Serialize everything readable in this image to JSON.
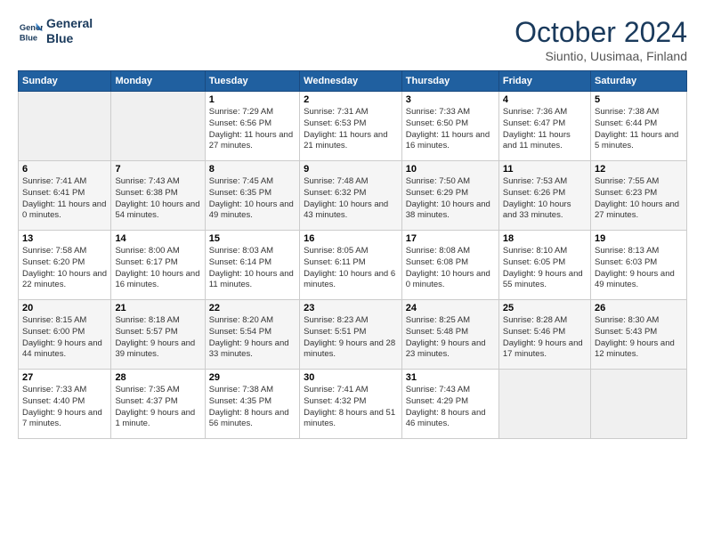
{
  "header": {
    "logo_line1": "General",
    "logo_line2": "Blue",
    "title": "October 2024",
    "subtitle": "Siuntio, Uusimaa, Finland"
  },
  "days_of_week": [
    "Sunday",
    "Monday",
    "Tuesday",
    "Wednesday",
    "Thursday",
    "Friday",
    "Saturday"
  ],
  "weeks": [
    [
      {
        "day": "",
        "empty": true
      },
      {
        "day": "",
        "empty": true
      },
      {
        "day": "1",
        "sunrise": "Sunrise: 7:29 AM",
        "sunset": "Sunset: 6:56 PM",
        "daylight": "Daylight: 11 hours and 27 minutes."
      },
      {
        "day": "2",
        "sunrise": "Sunrise: 7:31 AM",
        "sunset": "Sunset: 6:53 PM",
        "daylight": "Daylight: 11 hours and 21 minutes."
      },
      {
        "day": "3",
        "sunrise": "Sunrise: 7:33 AM",
        "sunset": "Sunset: 6:50 PM",
        "daylight": "Daylight: 11 hours and 16 minutes."
      },
      {
        "day": "4",
        "sunrise": "Sunrise: 7:36 AM",
        "sunset": "Sunset: 6:47 PM",
        "daylight": "Daylight: 11 hours and 11 minutes."
      },
      {
        "day": "5",
        "sunrise": "Sunrise: 7:38 AM",
        "sunset": "Sunset: 6:44 PM",
        "daylight": "Daylight: 11 hours and 5 minutes."
      }
    ],
    [
      {
        "day": "6",
        "sunrise": "Sunrise: 7:41 AM",
        "sunset": "Sunset: 6:41 PM",
        "daylight": "Daylight: 11 hours and 0 minutes."
      },
      {
        "day": "7",
        "sunrise": "Sunrise: 7:43 AM",
        "sunset": "Sunset: 6:38 PM",
        "daylight": "Daylight: 10 hours and 54 minutes."
      },
      {
        "day": "8",
        "sunrise": "Sunrise: 7:45 AM",
        "sunset": "Sunset: 6:35 PM",
        "daylight": "Daylight: 10 hours and 49 minutes."
      },
      {
        "day": "9",
        "sunrise": "Sunrise: 7:48 AM",
        "sunset": "Sunset: 6:32 PM",
        "daylight": "Daylight: 10 hours and 43 minutes."
      },
      {
        "day": "10",
        "sunrise": "Sunrise: 7:50 AM",
        "sunset": "Sunset: 6:29 PM",
        "daylight": "Daylight: 10 hours and 38 minutes."
      },
      {
        "day": "11",
        "sunrise": "Sunrise: 7:53 AM",
        "sunset": "Sunset: 6:26 PM",
        "daylight": "Daylight: 10 hours and 33 minutes."
      },
      {
        "day": "12",
        "sunrise": "Sunrise: 7:55 AM",
        "sunset": "Sunset: 6:23 PM",
        "daylight": "Daylight: 10 hours and 27 minutes."
      }
    ],
    [
      {
        "day": "13",
        "sunrise": "Sunrise: 7:58 AM",
        "sunset": "Sunset: 6:20 PM",
        "daylight": "Daylight: 10 hours and 22 minutes."
      },
      {
        "day": "14",
        "sunrise": "Sunrise: 8:00 AM",
        "sunset": "Sunset: 6:17 PM",
        "daylight": "Daylight: 10 hours and 16 minutes."
      },
      {
        "day": "15",
        "sunrise": "Sunrise: 8:03 AM",
        "sunset": "Sunset: 6:14 PM",
        "daylight": "Daylight: 10 hours and 11 minutes."
      },
      {
        "day": "16",
        "sunrise": "Sunrise: 8:05 AM",
        "sunset": "Sunset: 6:11 PM",
        "daylight": "Daylight: 10 hours and 6 minutes."
      },
      {
        "day": "17",
        "sunrise": "Sunrise: 8:08 AM",
        "sunset": "Sunset: 6:08 PM",
        "daylight": "Daylight: 10 hours and 0 minutes."
      },
      {
        "day": "18",
        "sunrise": "Sunrise: 8:10 AM",
        "sunset": "Sunset: 6:05 PM",
        "daylight": "Daylight: 9 hours and 55 minutes."
      },
      {
        "day": "19",
        "sunrise": "Sunrise: 8:13 AM",
        "sunset": "Sunset: 6:03 PM",
        "daylight": "Daylight: 9 hours and 49 minutes."
      }
    ],
    [
      {
        "day": "20",
        "sunrise": "Sunrise: 8:15 AM",
        "sunset": "Sunset: 6:00 PM",
        "daylight": "Daylight: 9 hours and 44 minutes."
      },
      {
        "day": "21",
        "sunrise": "Sunrise: 8:18 AM",
        "sunset": "Sunset: 5:57 PM",
        "daylight": "Daylight: 9 hours and 39 minutes."
      },
      {
        "day": "22",
        "sunrise": "Sunrise: 8:20 AM",
        "sunset": "Sunset: 5:54 PM",
        "daylight": "Daylight: 9 hours and 33 minutes."
      },
      {
        "day": "23",
        "sunrise": "Sunrise: 8:23 AM",
        "sunset": "Sunset: 5:51 PM",
        "daylight": "Daylight: 9 hours and 28 minutes."
      },
      {
        "day": "24",
        "sunrise": "Sunrise: 8:25 AM",
        "sunset": "Sunset: 5:48 PM",
        "daylight": "Daylight: 9 hours and 23 minutes."
      },
      {
        "day": "25",
        "sunrise": "Sunrise: 8:28 AM",
        "sunset": "Sunset: 5:46 PM",
        "daylight": "Daylight: 9 hours and 17 minutes."
      },
      {
        "day": "26",
        "sunrise": "Sunrise: 8:30 AM",
        "sunset": "Sunset: 5:43 PM",
        "daylight": "Daylight: 9 hours and 12 minutes."
      }
    ],
    [
      {
        "day": "27",
        "sunrise": "Sunrise: 7:33 AM",
        "sunset": "Sunset: 4:40 PM",
        "daylight": "Daylight: 9 hours and 7 minutes."
      },
      {
        "day": "28",
        "sunrise": "Sunrise: 7:35 AM",
        "sunset": "Sunset: 4:37 PM",
        "daylight": "Daylight: 9 hours and 1 minute."
      },
      {
        "day": "29",
        "sunrise": "Sunrise: 7:38 AM",
        "sunset": "Sunset: 4:35 PM",
        "daylight": "Daylight: 8 hours and 56 minutes."
      },
      {
        "day": "30",
        "sunrise": "Sunrise: 7:41 AM",
        "sunset": "Sunset: 4:32 PM",
        "daylight": "Daylight: 8 hours and 51 minutes."
      },
      {
        "day": "31",
        "sunrise": "Sunrise: 7:43 AM",
        "sunset": "Sunset: 4:29 PM",
        "daylight": "Daylight: 8 hours and 46 minutes."
      },
      {
        "day": "",
        "empty": true
      },
      {
        "day": "",
        "empty": true
      }
    ]
  ]
}
